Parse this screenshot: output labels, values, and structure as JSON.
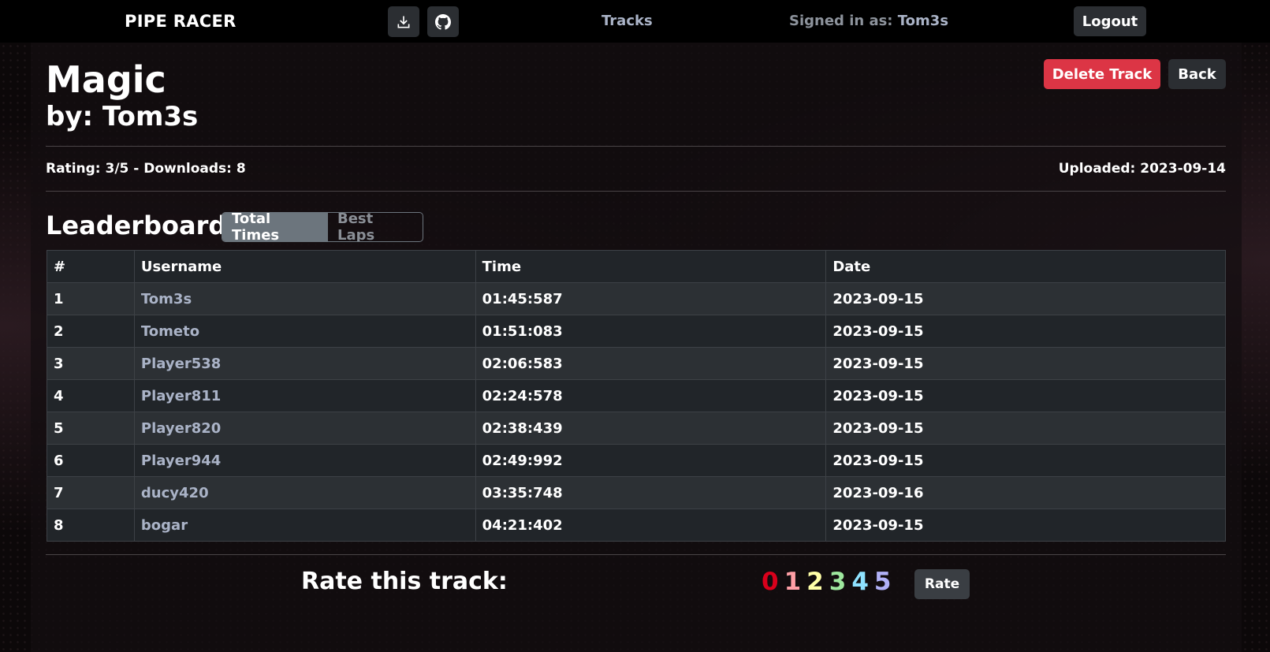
{
  "nav": {
    "brand": "PIPE RACER",
    "tracks_link": "Tracks",
    "signed_in_prefix": "Signed in as: ",
    "signed_in_user": "Tom3s",
    "logout_label": "Logout",
    "icons": [
      "download-icon",
      "github-icon"
    ]
  },
  "track": {
    "name": "Magic",
    "author_line": "by: Tom3s",
    "meta": "Rating: 3/5 - Downloads: 8",
    "uploaded": "Uploaded: 2023-09-14",
    "delete_label": "Delete Track",
    "back_label": "Back"
  },
  "leaderboard": {
    "title": "Leaderboard",
    "tabs": [
      "Total Times",
      "Best Laps"
    ],
    "active_tab": "Total Times",
    "columns": [
      "#",
      "Username",
      "Time",
      "Date"
    ],
    "rows": [
      [
        "1",
        "Tom3s",
        "01:45:587",
        "2023-09-15"
      ],
      [
        "2",
        "Tometo",
        "01:51:083",
        "2023-09-15"
      ],
      [
        "3",
        "Player538",
        "02:06:583",
        "2023-09-15"
      ],
      [
        "4",
        "Player811",
        "02:24:578",
        "2023-09-15"
      ],
      [
        "5",
        "Player820",
        "02:38:439",
        "2023-09-15"
      ],
      [
        "6",
        "Player944",
        "02:49:992",
        "2023-09-15"
      ],
      [
        "7",
        "ducy420",
        "03:35:748",
        "2023-09-16"
      ],
      [
        "8",
        "bogar",
        "04:21:402",
        "2023-09-15"
      ]
    ]
  },
  "rating": {
    "label": "Rate this track:",
    "options": [
      {
        "value": "0",
        "color": "#d9001b"
      },
      {
        "value": "1",
        "color": "#ff9fa6"
      },
      {
        "value": "2",
        "color": "#ffffa8"
      },
      {
        "value": "3",
        "color": "#9ee79e"
      },
      {
        "value": "4",
        "color": "#8fe2ff"
      },
      {
        "value": "5",
        "color": "#b1b1f7"
      }
    ],
    "button_label": "Rate"
  },
  "colors": {
    "link": "#aab3c7",
    "danger": "#dc3545",
    "secondary": "#6c757d"
  }
}
